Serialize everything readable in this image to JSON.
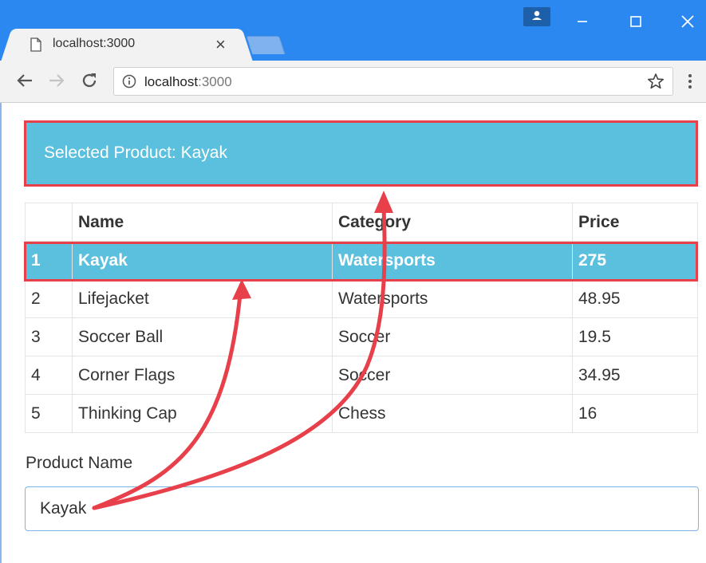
{
  "browser": {
    "tab_title": "localhost:3000",
    "tab_close": "×",
    "url_host": "localhost",
    "url_port": ":3000"
  },
  "page": {
    "selected_banner": "Selected Product: Kayak",
    "table": {
      "headers": [
        "",
        "Name",
        "Category",
        "Price"
      ],
      "rows": [
        {
          "id": "1",
          "name": "Kayak",
          "category": "Watersports",
          "price": "275",
          "selected": true
        },
        {
          "id": "2",
          "name": "Lifejacket",
          "category": "Watersports",
          "price": "48.95"
        },
        {
          "id": "3",
          "name": "Soccer Ball",
          "category": "Soccer",
          "price": "19.5"
        },
        {
          "id": "4",
          "name": "Corner Flags",
          "category": "Soccer",
          "price": "34.95"
        },
        {
          "id": "5",
          "name": "Thinking Cap",
          "category": "Chess",
          "price": "16"
        }
      ]
    },
    "field_label": "Product Name",
    "field_value": "Kayak"
  },
  "colors": {
    "titlebar": "#2b88f0",
    "info": "#5bc0de",
    "annotation": "#e8404b"
  }
}
